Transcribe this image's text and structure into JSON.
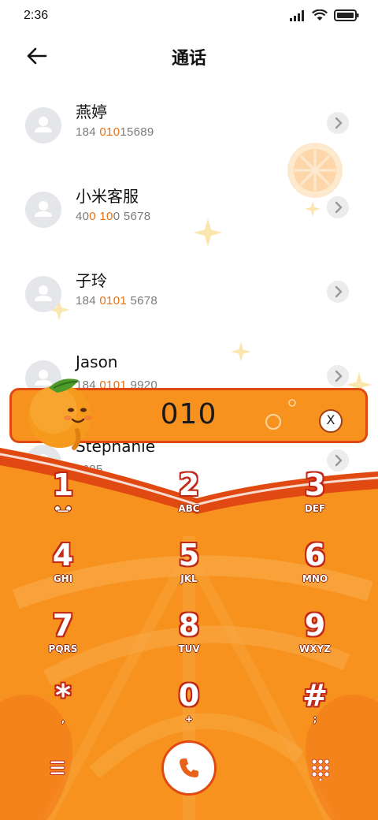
{
  "status_bar": {
    "time": "2:36",
    "icons": [
      "signal-icon",
      "wifi-icon",
      "battery-icon"
    ]
  },
  "header": {
    "title": "通话",
    "back_icon": "back-arrow-icon"
  },
  "contacts": [
    {
      "name": "燕婷",
      "num_pre": "184 ",
      "num_hl": "010",
      "num_post": "15689"
    },
    {
      "name": "小米客服",
      "num_pre": "40",
      "num_hl": "0 10",
      "num_post": "0 5678"
    },
    {
      "name": "子玲",
      "num_pre": "184 ",
      "num_hl": "0101",
      "num_post": " 5678"
    },
    {
      "name": "Jason",
      "num_pre": "184 ",
      "num_hl": "0101",
      "num_post": " 9920"
    },
    {
      "name": "Stephanie",
      "num_pre": "",
      "num_hl": "",
      "num_post": "5685"
    }
  ],
  "search": {
    "query": "010",
    "clear_label": "X"
  },
  "keypad": {
    "keys": [
      {
        "num": "1",
        "letters": ""
      },
      {
        "num": "2",
        "letters": "ABC"
      },
      {
        "num": "3",
        "letters": "DEF"
      },
      {
        "num": "4",
        "letters": "GHI"
      },
      {
        "num": "5",
        "letters": "JKL"
      },
      {
        "num": "6",
        "letters": "MNO"
      },
      {
        "num": "7",
        "letters": "PQRS"
      },
      {
        "num": "8",
        "letters": "TUV"
      },
      {
        "num": "9",
        "letters": "WXYZ"
      },
      {
        "num": "*",
        "letters": ","
      },
      {
        "num": "0",
        "letters": "+"
      },
      {
        "num": "#",
        "letters": ";"
      }
    ]
  },
  "bottom_bar": {
    "menu_icon": "menu-icon",
    "call_icon": "phone-icon",
    "keypad_icon": "keypad-grid-icon"
  },
  "colors": {
    "accent_orange": "#f7921e",
    "accent_red": "#e04a12",
    "highlight": "#e8700f"
  }
}
